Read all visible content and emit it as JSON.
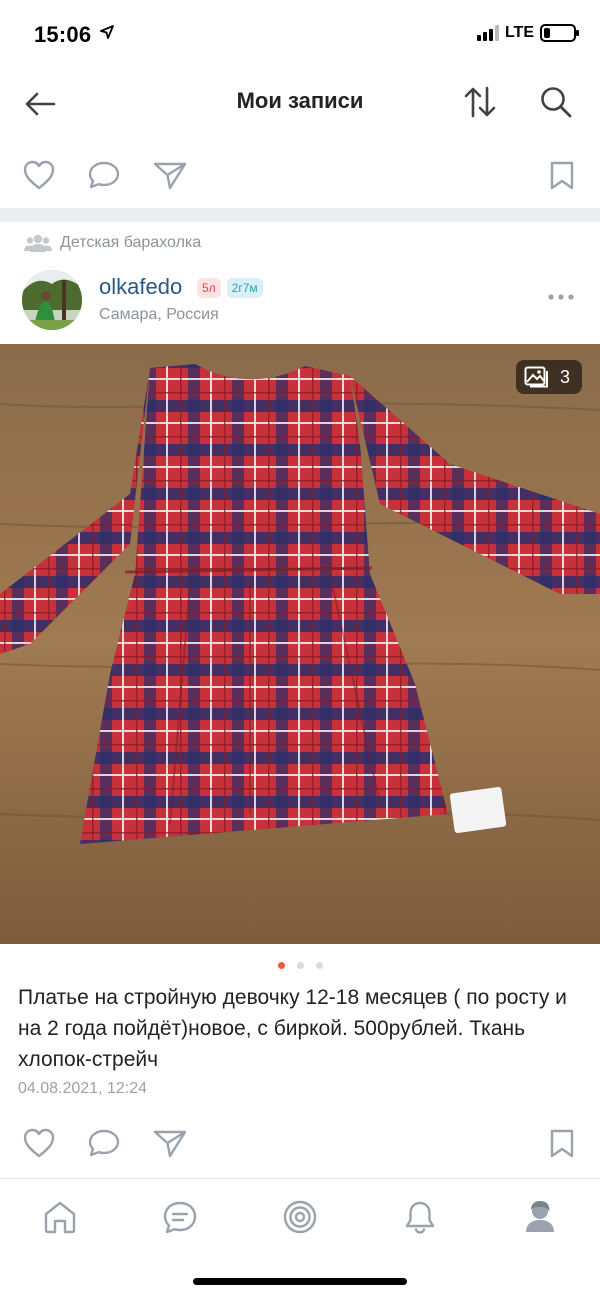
{
  "status": {
    "time": "15:06",
    "network": "LTE",
    "battery_level": 0.2
  },
  "nav": {
    "title": "Мои записи",
    "back_icon": "arrow-left-icon",
    "sort_icon": "sort-arrows-icon",
    "search_icon": "search-icon"
  },
  "post": {
    "community": "Детская барахолка",
    "author": "olkafedo",
    "badges": [
      "5л",
      "2г7м"
    ],
    "location": "Самара, Россия",
    "photo_count": "3",
    "text": "Платье на стройную девочку 12-18 месяцев ( по росту и на 2 года пойдёт)новое, с биркой. 500рублей. Ткань хлопок-стрейч",
    "date": "04.08.2021, 12:24",
    "active_photo_index": 0,
    "total_photos": 3
  },
  "tabs": [
    "home-icon",
    "messages-icon",
    "discover-icon",
    "notifications-icon",
    "profile-icon"
  ],
  "colors": {
    "accent_link": "#2a5885",
    "icon_gray": "#99a2ad",
    "dot_active": "#ef5b3b"
  }
}
